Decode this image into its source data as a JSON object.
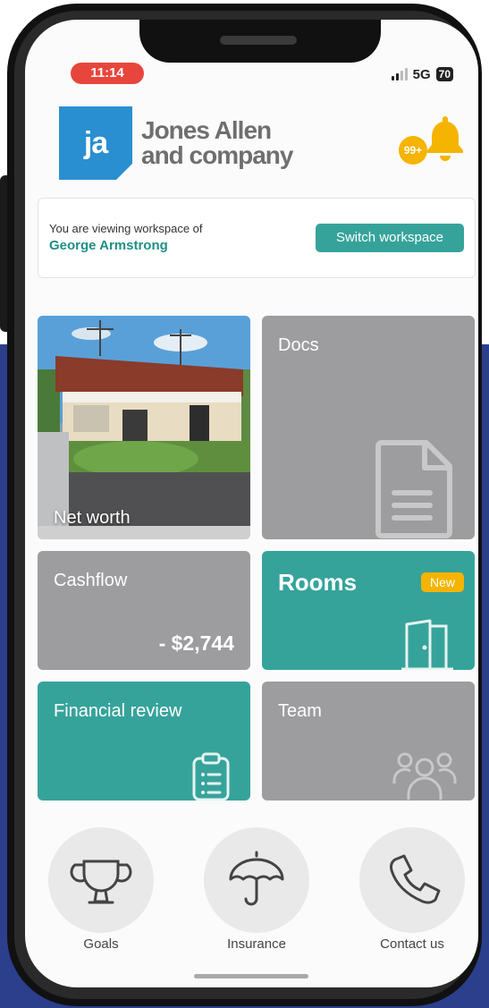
{
  "status": {
    "time": "11:14",
    "network": "5G",
    "battery": "70"
  },
  "brand": {
    "logo_letters": "ja",
    "name_line1": "Jones Allen",
    "name_line2": "and company"
  },
  "notifications": {
    "badge": "99+",
    "icon": "bell-icon"
  },
  "workspace": {
    "label": "You are viewing workspace of",
    "name": "George Armstrong",
    "switch_label": "Switch workspace"
  },
  "tiles": {
    "net_worth": {
      "label": "Net worth"
    },
    "docs": {
      "label": "Docs",
      "icon": "document-icon"
    },
    "cashflow": {
      "label": "Cashflow",
      "amount": "- $2,744"
    },
    "rooms": {
      "label": "Rooms",
      "badge": "New",
      "icon": "door-icon"
    },
    "financial_review": {
      "label": "Financial review",
      "icon": "clipboard-icon"
    },
    "team": {
      "label": "Team",
      "icon": "people-icon"
    }
  },
  "bottom_nav": [
    {
      "label": "Goals",
      "icon": "trophy-icon"
    },
    {
      "label": "Insurance",
      "icon": "umbrella-icon"
    },
    {
      "label": "Contact us",
      "icon": "phone-icon"
    }
  ],
  "colors": {
    "teal": "#36a39b",
    "gray_tile": "#9d9c9e",
    "accent_yellow": "#f5b400",
    "logo_blue": "#2a8fd1",
    "time_red": "#e8453c"
  }
}
